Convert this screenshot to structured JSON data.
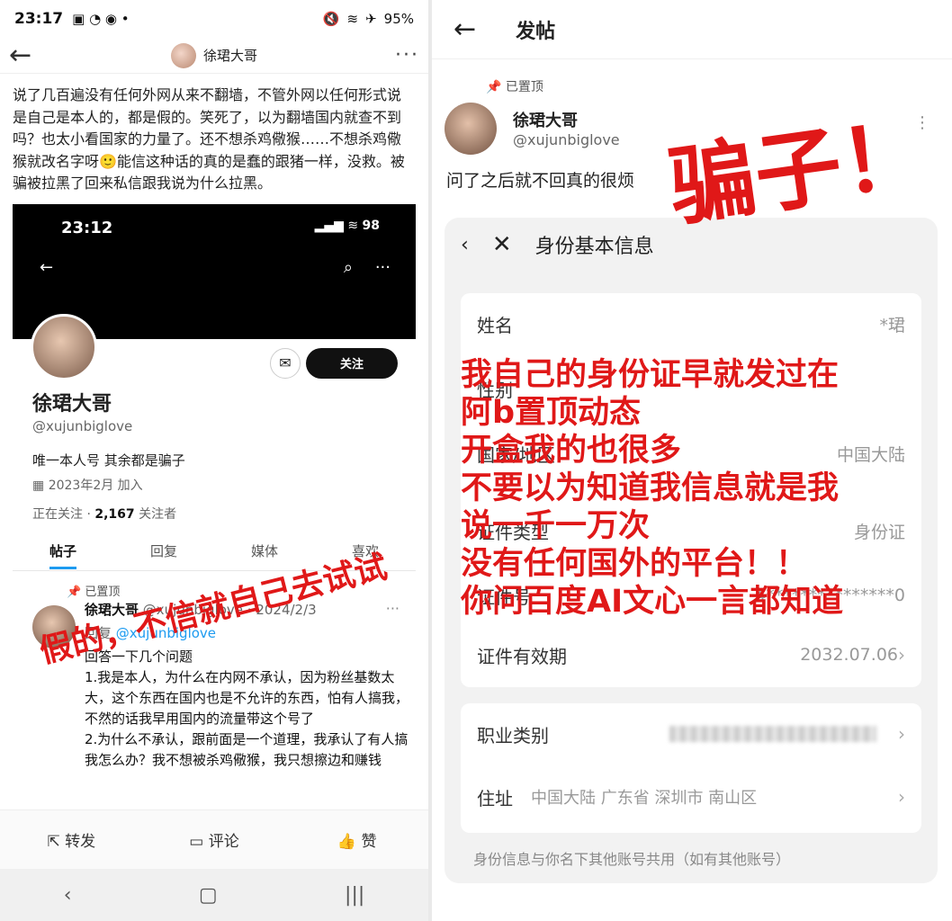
{
  "left": {
    "status": {
      "time": "23:17",
      "battery": "95%"
    },
    "topbar": {
      "user": "徐珺大哥",
      "more": "···"
    },
    "post_text": "说了几百遍没有任何外网从来不翻墙，不管外网以任何形式说是自己是本人的，都是假的。笑死了，以为翻墙国内就查不到吗？也太小看国家的力量了。还不想杀鸡儆猴……不想杀鸡儆猴就改名字呀🙂能信这种话的真的是蠢的跟猪一样，没救。被骗被拉黑了回来私信跟我说为什么拉黑。",
    "embed": {
      "time": "23:12",
      "battery": "98",
      "follow_label": "关注",
      "name": "徐珺大哥",
      "handle": "@xujunbiglove",
      "bio": "唯一本人号 其余都是骗子",
      "joined": "2023年2月 加入",
      "stats_prefix": "正在关注",
      "followers": "2,167",
      "followers_label": "关注者",
      "tabs": [
        "帖子",
        "回复",
        "媒体",
        "喜欢"
      ],
      "pinned": "已置顶",
      "tweet": {
        "name": "徐珺大哥",
        "meta": "@xujunbiglove · 2024/2/3",
        "reply_prefix": "回复",
        "reply_to": "@xujunbiglove",
        "body": "回答一下几个问题\n1.我是本人，为什么在内网不承认，因为粉丝基数太大，这个东西在国内也是不允许的东西，怕有人搞我，不然的话我早用国内的流量带这个号了\n2.为什么不承认，跟前面是一个道理，我承认了有人搞我怎么办？我不想被杀鸡儆猴，我只想擦边和赚钱"
      }
    },
    "stamp": "假的，不信就自己去试试",
    "actions": {
      "repost": "转发",
      "comment": "评论",
      "like": "赞"
    }
  },
  "right": {
    "topbar": {
      "title": "发帖"
    },
    "pinned": "已置顶",
    "name": "徐珺大哥",
    "handle": "@xujunbiglove",
    "text": "问了之后就不回真的很烦",
    "card": {
      "title": "身份基本信息",
      "rows": [
        {
          "label": "姓名",
          "value": "*珺"
        },
        {
          "label": "性别",
          "value": ""
        },
        {
          "label": "国家/地区",
          "value": "中国大陆"
        },
        {
          "label": "证件类型",
          "value": "身份证"
        },
        {
          "label": "证件号",
          "value": "4***************0"
        },
        {
          "label": "证件有效期",
          "value": "2032.07.06"
        }
      ],
      "job_label": "职业类别",
      "addr_label": "住址",
      "addr_value": "中国大陆 广东省 深圳市 南山区",
      "footnote": "身份信息与你名下其他账号共用（如有其他账号）"
    },
    "stamp": "骗子！",
    "overlay": [
      "我自己的身份证早就发过在",
      "阿b置顶动态",
      "开盒我的也很多",
      "不要以为知道我信息就是我",
      "说一千一万次",
      "没有任何国外的平台！！",
      "你问百度AI文心一言都知道"
    ]
  }
}
